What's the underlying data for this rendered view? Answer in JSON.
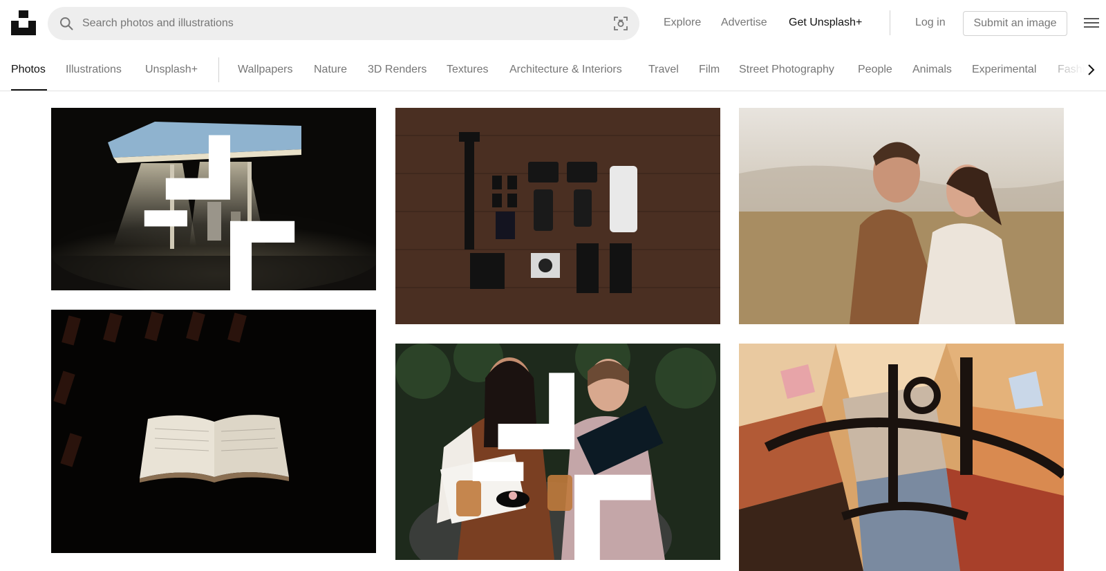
{
  "header": {
    "search_placeholder": "Search photos and illustrations",
    "nav": {
      "explore": "Explore",
      "advertise": "Advertise",
      "get_plus": "Get Unsplash+",
      "login": "Log in",
      "submit": "Submit an image"
    }
  },
  "tabs": [
    "Photos",
    "Illustrations",
    "Unsplash+",
    "Wallpapers",
    "Nature",
    "3D Renders",
    "Textures",
    "Architecture & Interiors",
    "Travel",
    "Film",
    "Street Photography",
    "People",
    "Animals",
    "Experimental",
    "Fashion"
  ],
  "active_tab": "Photos",
  "photos": [
    {
      "subject": "gas-station-at-night",
      "plus": true
    },
    {
      "subject": "camera-gear-flatlay",
      "plus": false
    },
    {
      "subject": "couple-embracing",
      "plus": false
    },
    {
      "subject": "open-book-in-dark",
      "plus": false
    },
    {
      "subject": "two-women-reading",
      "plus": true
    },
    {
      "subject": "abstract-painting",
      "plus": false
    }
  ],
  "colors": {
    "text_primary": "#111111",
    "text_secondary": "#767676",
    "search_bg": "#eeeeee",
    "border": "#d1d1d1"
  }
}
